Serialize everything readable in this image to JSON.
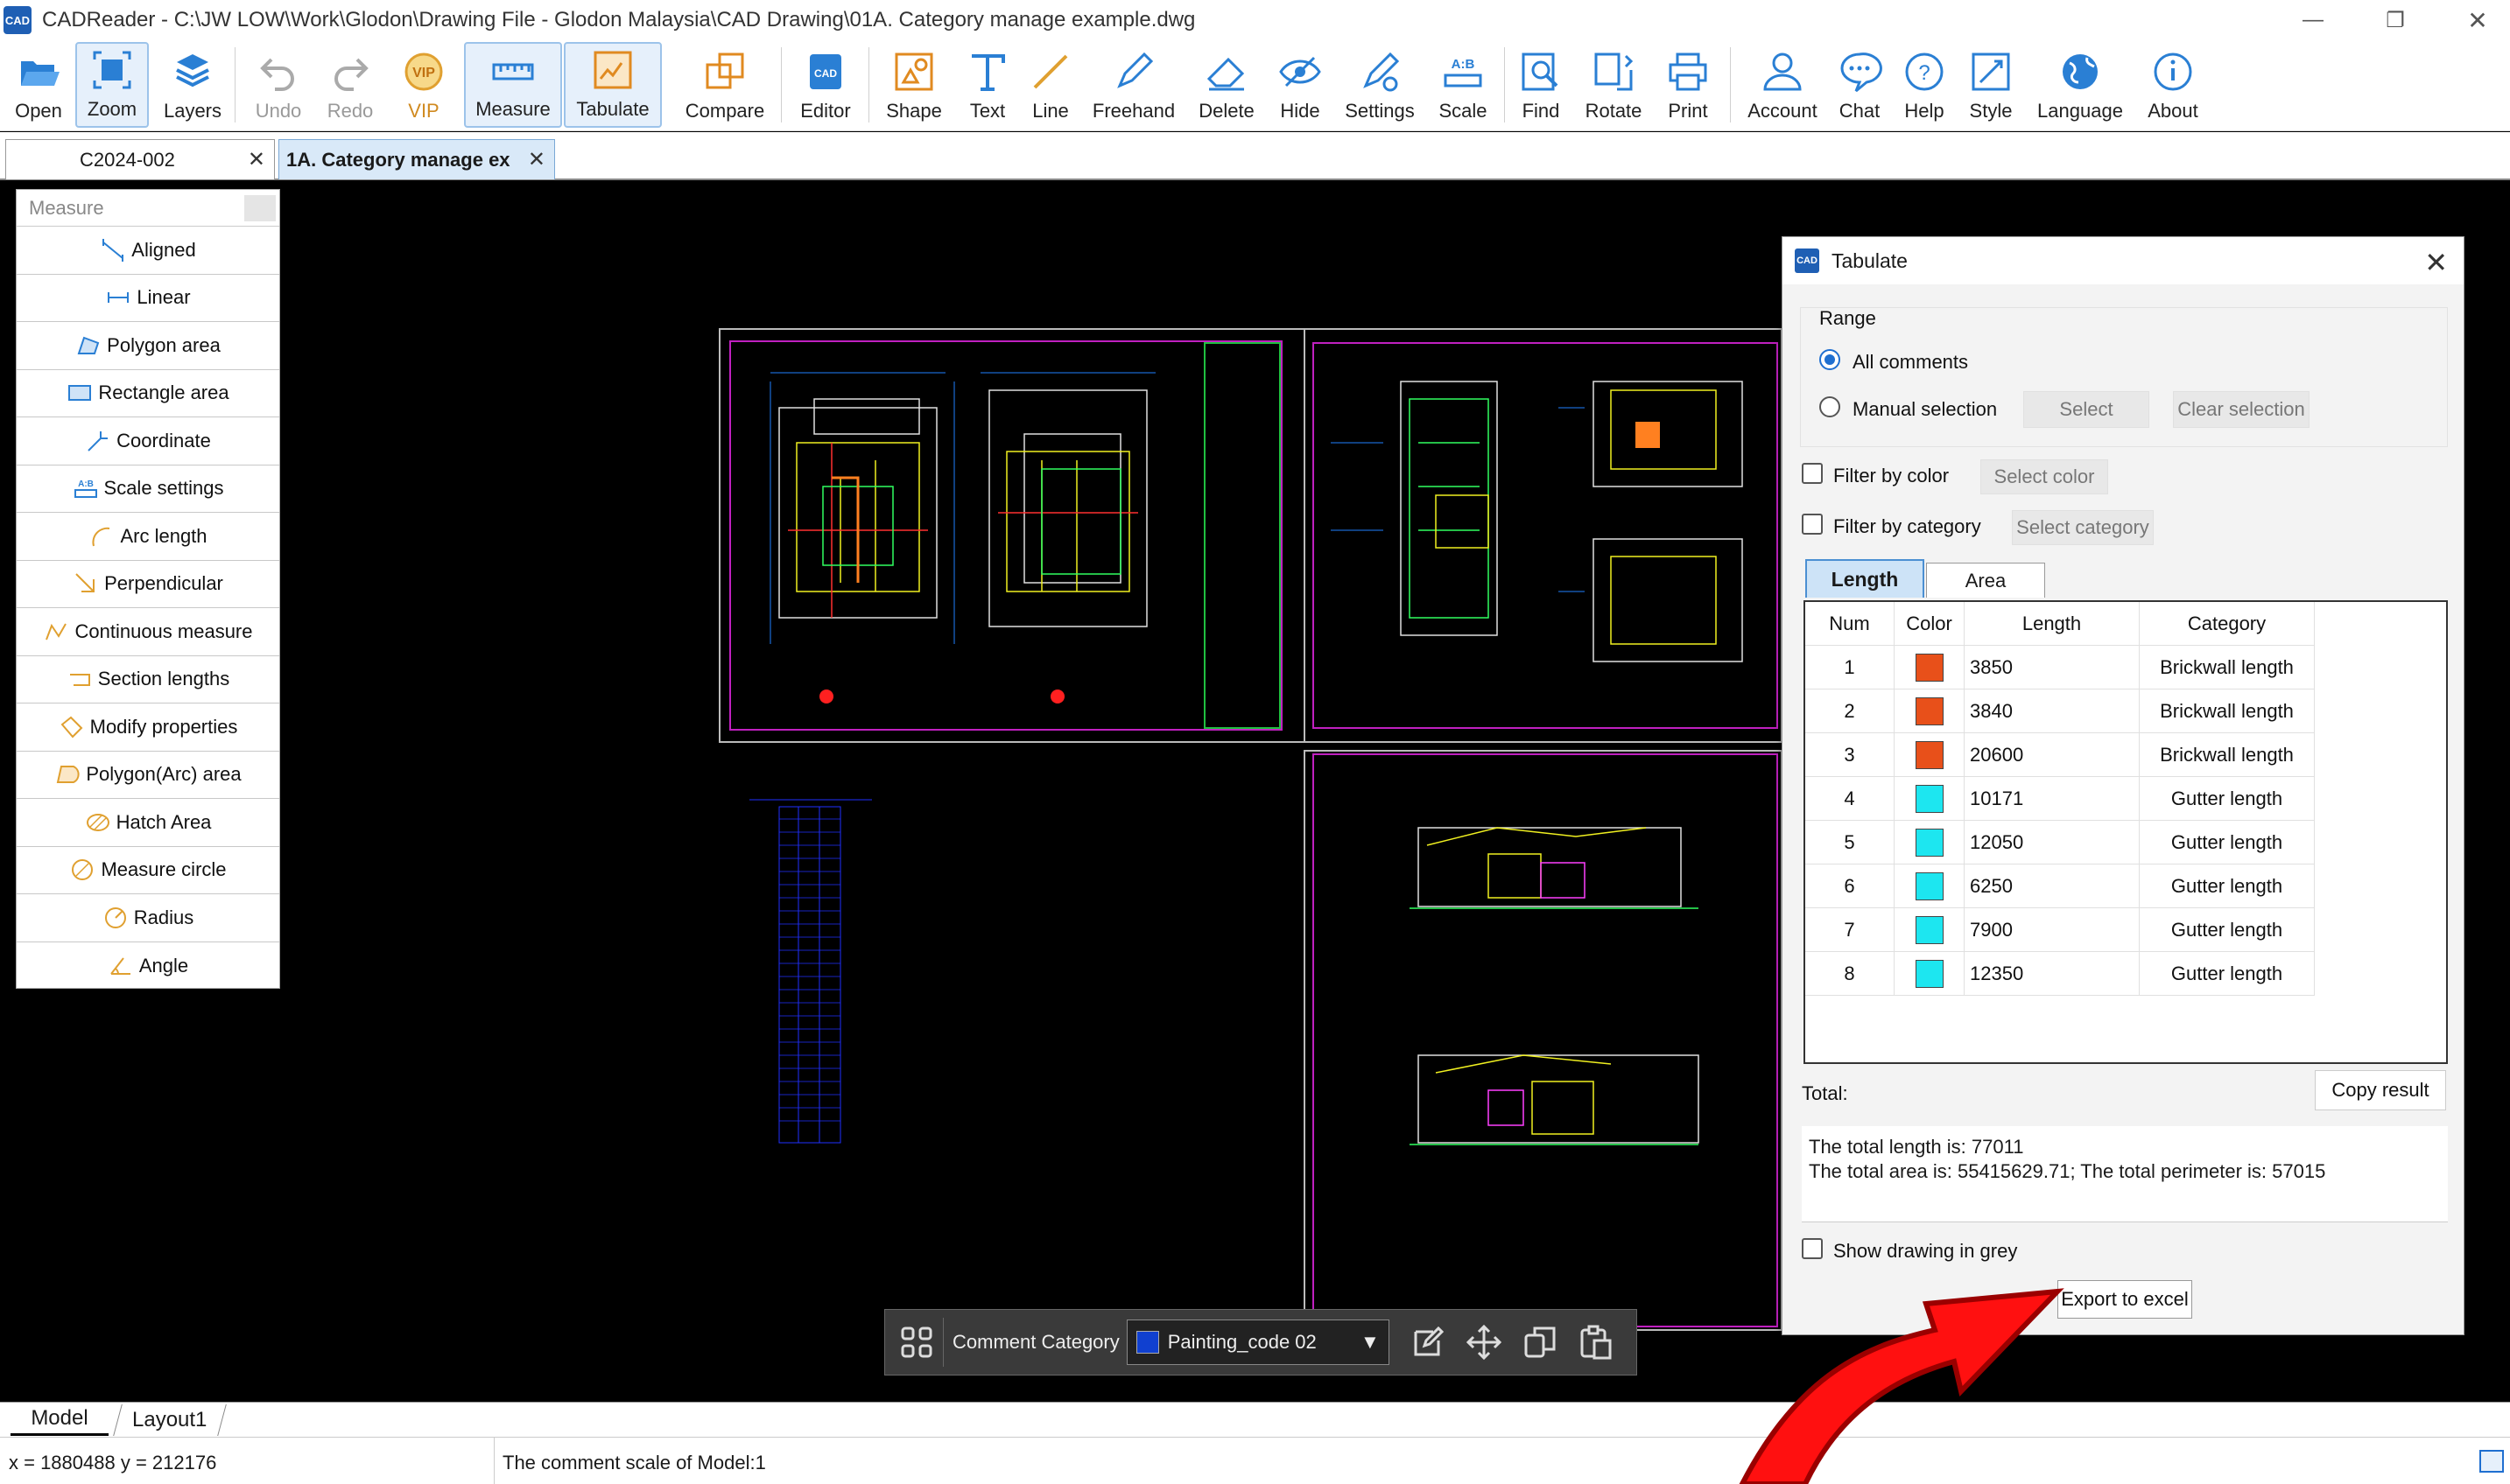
{
  "window": {
    "app_logo": "CAD",
    "title": "CADReader - C:\\JW LOW\\Work\\Glodon\\Drawing File - Glodon Malaysia\\CAD Drawing\\01A. Category manage example.dwg"
  },
  "toolbar": {
    "open": "Open",
    "zoom": "Zoom",
    "layers": "Layers",
    "undo": "Undo",
    "redo": "Redo",
    "vip": "VIP",
    "measure": "Measure",
    "tabulate": "Tabulate",
    "compare": "Compare",
    "editor": "Editor",
    "shape": "Shape",
    "text": "Text",
    "line": "Line",
    "freehand": "Freehand",
    "delete": "Delete",
    "hide": "Hide",
    "settings": "Settings",
    "scale": "Scale",
    "find": "Find",
    "rotate": "Rotate",
    "print": "Print",
    "account": "Account",
    "chat": "Chat",
    "help": "Help",
    "style": "Style",
    "language": "Language",
    "about": "About"
  },
  "doc_tabs": [
    "C2024-002",
    "1A. Category manage ex"
  ],
  "measure_panel": {
    "title": "Measure",
    "items": [
      "Aligned",
      "Linear",
      "Polygon area",
      "Rectangle area",
      "Coordinate",
      "Scale settings",
      "Arc length",
      "Perpendicular",
      "Continuous measure",
      "Section lengths",
      "Modify properties",
      "Polygon(Arc) area",
      "Hatch Area",
      "Measure circle",
      "Radius",
      "Angle"
    ]
  },
  "tabulate": {
    "logo": "CAD",
    "title": "Tabulate",
    "range_label": "Range",
    "all_comments": "All comments",
    "manual_selection": "Manual selection",
    "select_button": "Select",
    "clear_selection": "Clear selection",
    "filter_color": "Filter by color",
    "select_color": "Select color",
    "filter_category": "Filter by category",
    "select_category": "Select category",
    "tab_length": "Length",
    "tab_area": "Area",
    "columns": [
      "Num",
      "Color",
      "Length",
      "Category"
    ],
    "rows": [
      {
        "num": "1",
        "color": "#e8501a",
        "length": "3850",
        "category": "Brickwall length"
      },
      {
        "num": "2",
        "color": "#e8501a",
        "length": "3840",
        "category": "Brickwall length"
      },
      {
        "num": "3",
        "color": "#e8501a",
        "length": "20600",
        "category": "Brickwall length"
      },
      {
        "num": "4",
        "color": "#1de6f0",
        "length": "10171",
        "category": "Gutter length"
      },
      {
        "num": "5",
        "color": "#1de6f0",
        "length": "12050",
        "category": "Gutter length"
      },
      {
        "num": "6",
        "color": "#1de6f0",
        "length": "6250",
        "category": "Gutter length"
      },
      {
        "num": "7",
        "color": "#1de6f0",
        "length": "7900",
        "category": "Gutter length"
      },
      {
        "num": "8",
        "color": "#1de6f0",
        "length": "12350",
        "category": "Gutter length"
      }
    ],
    "total_label": "Total:",
    "copy_result": "Copy result",
    "total_length": "The total length is: 77011",
    "total_area": "The total area is: 55415629.71; The total perimeter is: 57015",
    "show_grey": "Show drawing in grey",
    "export": "Export to excel"
  },
  "comment_bar": {
    "label": "Comment Category",
    "value": "Painting_code 02",
    "swatch_color": "#1040d0"
  },
  "layout_tabs": [
    "Model",
    "Layout1"
  ],
  "status": {
    "coords": "x = 1880488 y = 212176",
    "scale_text": "The comment scale of Model:1"
  }
}
